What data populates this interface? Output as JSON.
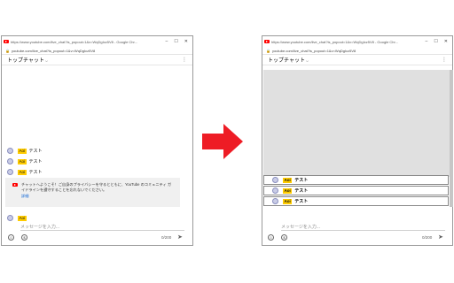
{
  "left_window": {
    "title": "https://www.youtube.com/live_chat?is_popout=1&v=WqDgIcz5V8 - Google Chr...",
    "url": "youtube.com/live_chat?is_popout=1&v=WqDgIcz5V8",
    "header": "トップチャット",
    "messages": [
      {
        "author": "Aoi",
        "text": "テスト"
      },
      {
        "author": "Aoi",
        "text": "テスト"
      },
      {
        "author": "Aoi",
        "text": "テスト"
      }
    ],
    "notice": {
      "text": "チャットへようこそ！ご自身のプライバシーを守るとともに、YouTube のコミュニティ ガイドラインを遵守することを忘れないでください。",
      "link": "詳細"
    },
    "composer": {
      "author": "Aoi",
      "placeholder": "メッセージを入力...",
      "counter": "0/200"
    }
  },
  "right_window": {
    "title": "https://www.youtube.com/live_chat?is_popout=1&v=WqDgIcz5V8 - Google Chr...",
    "url": "youtube.com/live_chat?is_popout=1&v=WqDgIcz5V8",
    "header": "トップチャット",
    "messages": [
      {
        "author": "Aoi",
        "text": "テスト"
      },
      {
        "author": "Aoi",
        "text": "テスト"
      },
      {
        "author": "Aoi",
        "text": "テスト"
      }
    ],
    "composer": {
      "placeholder": "メッセージを入力...",
      "counter": "0/200"
    }
  },
  "colors": {
    "arrow": "#ee1c25",
    "badge": "#ffcc00",
    "youtube_red": "#ff0000",
    "link": "#065fd4",
    "placeholder_panel": "#e0e0e0"
  },
  "icons": {
    "minimize": "minimize-icon",
    "maximize": "maximize-icon",
    "close": "close-icon",
    "menu": "kebab-menu-icon",
    "emoji": "emoji-icon",
    "currency": "super-chat-icon",
    "send": "send-icon"
  }
}
